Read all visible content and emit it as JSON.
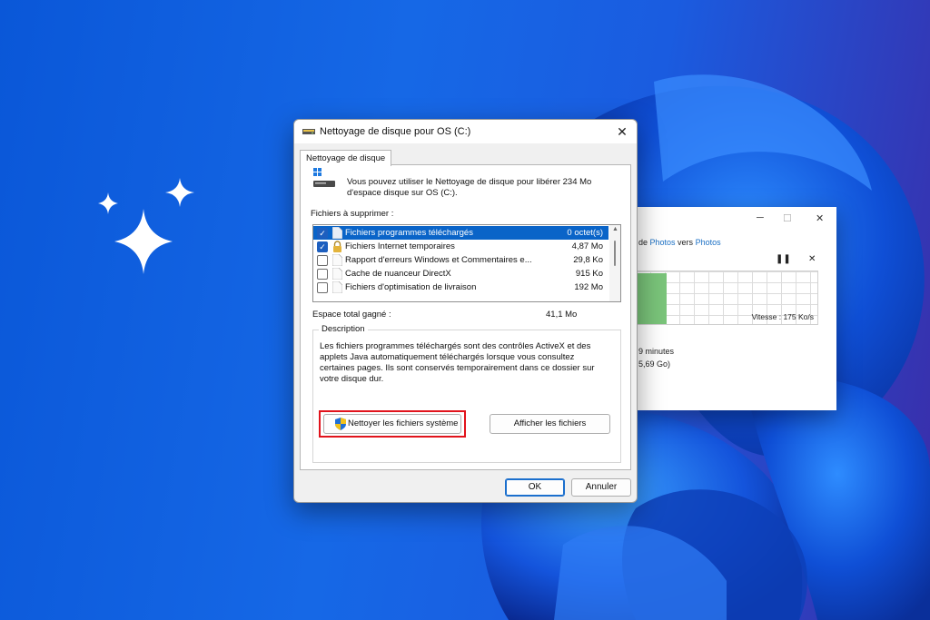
{
  "copy_window": {
    "route_prefix": "de ",
    "source": "Photos",
    "route_middle": " vers ",
    "destination": "Photos",
    "speed": "Vitesse : 175 Ko/s",
    "time_remaining": "9 minutes",
    "size_remaining": "5,69 Go)"
  },
  "dialog": {
    "title": "Nettoyage de disque pour OS (C:)",
    "tab": "Nettoyage de disque",
    "intro": "Vous pouvez utiliser le Nettoyage de disque pour libérer 234 Mo d'espace disque sur OS (C:).",
    "files_label": "Fichiers à supprimer :",
    "items": [
      {
        "label": "Fichiers programmes téléchargés",
        "size": "0 octet(s)",
        "checked": true,
        "selected": true
      },
      {
        "label": "Fichiers Internet temporaires",
        "size": "4,87 Mo",
        "checked": true,
        "selected": false
      },
      {
        "label": "Rapport d'erreurs Windows et Commentaires e...",
        "size": "29,8 Ko",
        "checked": false,
        "selected": false
      },
      {
        "label": "Cache de nuanceur DirectX",
        "size": "915 Ko",
        "checked": false,
        "selected": false
      },
      {
        "label": "Fichiers d'optimisation de livraison",
        "size": "192 Mo",
        "checked": false,
        "selected": false
      }
    ],
    "total_label": "Espace total gagné :",
    "total_value": "41,1 Mo",
    "description_title": "Description",
    "description": "Les fichiers programmes téléchargés sont des contrôles ActiveX et des applets Java automatiquement téléchargés lorsque vous consultez certaines pages. Ils sont conservés temporairement dans ce dossier sur votre disque dur.",
    "clean_system_button": "Nettoyer les fichiers système",
    "view_files_button": "Afficher les fichiers",
    "ok_button": "OK",
    "cancel_button": "Annuler"
  },
  "colors": {
    "accent": "#0a64c8",
    "highlight_box": "#e1131c",
    "background": "#1668e6"
  },
  "icons": [
    "sparkles-icon",
    "disk-cleanup-icon",
    "drive-icon",
    "close-icon",
    "lock-icon",
    "file-icon",
    "uac-shield-icon"
  ]
}
